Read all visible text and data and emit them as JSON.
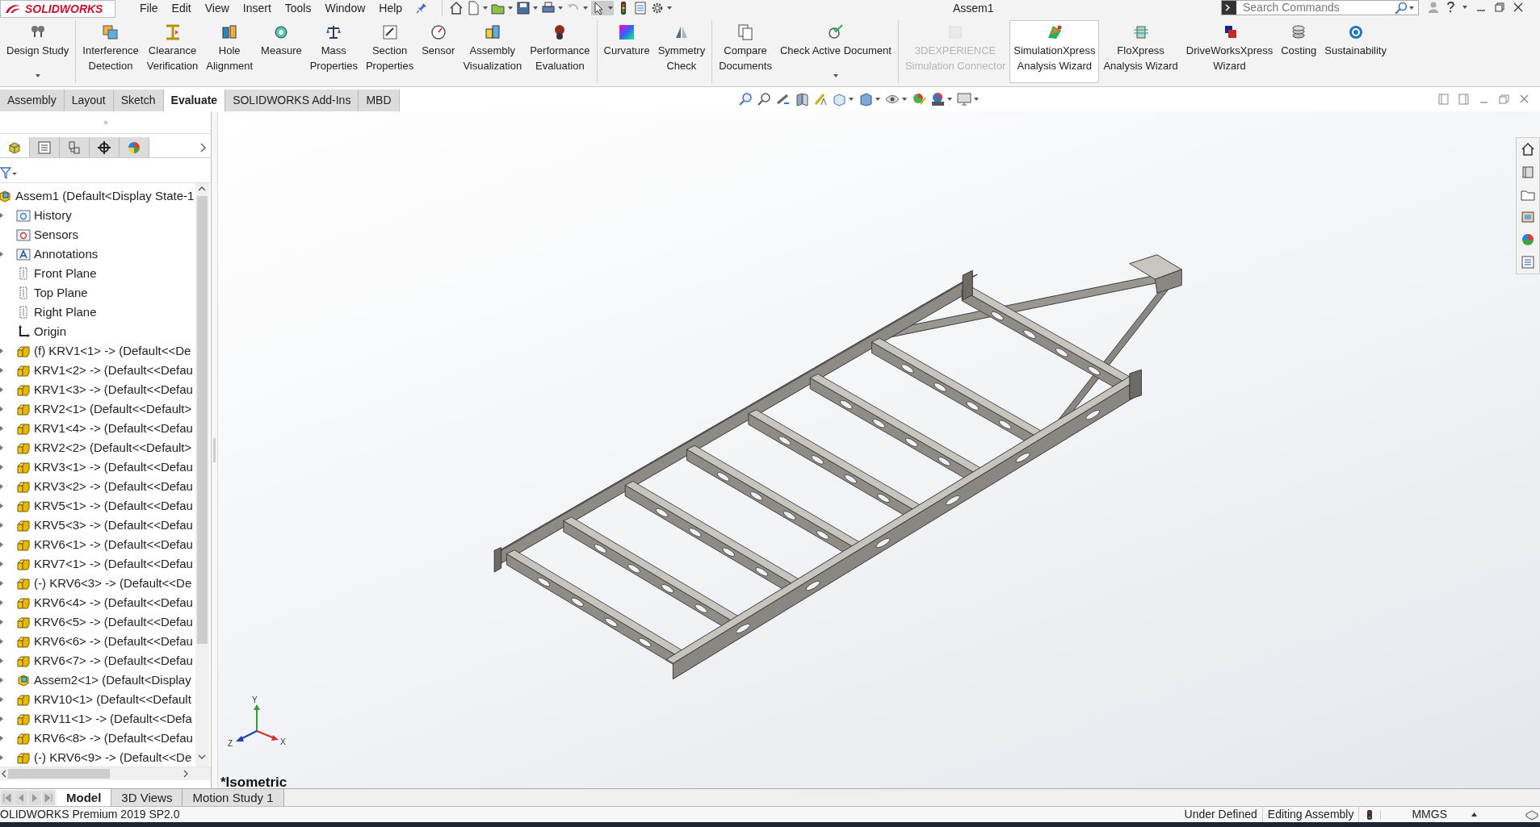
{
  "app": {
    "logo": "SOLIDWORKS",
    "menu": [
      "File",
      "Edit",
      "View",
      "Insert",
      "Tools",
      "Window",
      "Help"
    ],
    "title": "Assem1",
    "search": {
      "placeholder": "Search Commands"
    }
  },
  "ribbon": {
    "groups": [
      [
        {
          "lines": [
            "Design Study"
          ],
          "dropdown": true,
          "disabled": false,
          "hovered": false
        }
      ],
      [
        {
          "lines": [
            "Interference",
            "Detection"
          ],
          "dropdown": false,
          "disabled": false,
          "hovered": false
        },
        {
          "lines": [
            "Clearance",
            "Verification"
          ],
          "dropdown": false,
          "disabled": false,
          "hovered": false
        },
        {
          "lines": [
            "Hole",
            "Alignment"
          ],
          "dropdown": false,
          "disabled": false,
          "hovered": false
        },
        {
          "lines": [
            "Measure"
          ],
          "dropdown": false,
          "disabled": false,
          "hovered": false
        },
        {
          "lines": [
            "Mass",
            "Properties"
          ],
          "dropdown": false,
          "disabled": false,
          "hovered": false
        },
        {
          "lines": [
            "Section",
            "Properties"
          ],
          "dropdown": false,
          "disabled": false,
          "hovered": false
        },
        {
          "lines": [
            "Sensor"
          ],
          "dropdown": false,
          "disabled": false,
          "hovered": false
        },
        {
          "lines": [
            "Assembly",
            "Visualization"
          ],
          "dropdown": false,
          "disabled": false,
          "hovered": false
        },
        {
          "lines": [
            "Performance",
            "Evaluation"
          ],
          "dropdown": false,
          "disabled": false,
          "hovered": false
        }
      ],
      [
        {
          "lines": [
            "Curvature"
          ],
          "dropdown": false,
          "disabled": false,
          "hovered": false
        },
        {
          "lines": [
            "Symmetry",
            "Check"
          ],
          "dropdown": false,
          "disabled": false,
          "hovered": false
        }
      ],
      [
        {
          "lines": [
            "Compare",
            "Documents"
          ],
          "dropdown": false,
          "disabled": false,
          "hovered": false
        },
        {
          "lines": [
            "Check Active Document"
          ],
          "dropdown": true,
          "disabled": false,
          "hovered": false
        }
      ],
      [
        {
          "lines": [
            "3DEXPERIENCE",
            "Simulation Connector"
          ],
          "dropdown": false,
          "disabled": true,
          "hovered": false
        },
        {
          "lines": [
            "SimulationXpress",
            "Analysis Wizard"
          ],
          "dropdown": false,
          "disabled": false,
          "hovered": true
        },
        {
          "lines": [
            "FloXpress",
            "Analysis Wizard"
          ],
          "dropdown": false,
          "disabled": false,
          "hovered": false
        },
        {
          "lines": [
            "DriveWorksXpress",
            "Wizard"
          ],
          "dropdown": false,
          "disabled": false,
          "hovered": false
        },
        {
          "lines": [
            "Costing"
          ],
          "dropdown": false,
          "disabled": false,
          "hovered": false
        },
        {
          "lines": [
            "Sustainability"
          ],
          "dropdown": false,
          "disabled": false,
          "hovered": false
        }
      ]
    ]
  },
  "tabs": [
    {
      "label": "Assembly",
      "selected": false
    },
    {
      "label": "Layout",
      "selected": false
    },
    {
      "label": "Sketch",
      "selected": false
    },
    {
      "label": "Evaluate",
      "selected": true
    },
    {
      "label": "SOLIDWORKS Add-Ins",
      "selected": false
    },
    {
      "label": "MBD",
      "selected": false
    }
  ],
  "panel_tabs": [
    {
      "selected": true
    },
    {
      "selected": false
    },
    {
      "selected": false
    },
    {
      "selected": false
    },
    {
      "selected": false
    }
  ],
  "feature_tree": {
    "root": {
      "label": "Assem1  (Default<Display State-1",
      "kind": "assembly",
      "expanded": true,
      "children": [
        {
          "label": "History",
          "kind": "history",
          "expanded": false
        },
        {
          "label": "Sensors",
          "kind": "sensors"
        },
        {
          "label": "Annotations",
          "kind": "annotations",
          "expanded": false
        },
        {
          "label": "Front Plane",
          "kind": "plane"
        },
        {
          "label": "Top Plane",
          "kind": "plane"
        },
        {
          "label": "Right Plane",
          "kind": "plane"
        },
        {
          "label": "Origin",
          "kind": "origin"
        },
        {
          "label": "(f) KRV1<1> -> (Default<<De",
          "kind": "part",
          "expanded": false
        },
        {
          "label": "KRV1<2> -> (Default<<Defau",
          "kind": "part",
          "expanded": false
        },
        {
          "label": "KRV1<3> -> (Default<<Defau",
          "kind": "part",
          "expanded": false
        },
        {
          "label": "KRV2<1> (Default<<Default>",
          "kind": "part",
          "expanded": false
        },
        {
          "label": "KRV1<4> -> (Default<<Defau",
          "kind": "part",
          "expanded": false
        },
        {
          "label": "KRV2<2> (Default<<Default>",
          "kind": "part",
          "expanded": false
        },
        {
          "label": "KRV3<1> -> (Default<<Defau",
          "kind": "part",
          "expanded": false
        },
        {
          "label": "KRV3<2> -> (Default<<Defau",
          "kind": "part",
          "expanded": false
        },
        {
          "label": "KRV5<1> -> (Default<<Defau",
          "kind": "part",
          "expanded": false
        },
        {
          "label": "KRV5<3> -> (Default<<Defau",
          "kind": "part",
          "expanded": false
        },
        {
          "label": "KRV6<1> -> (Default<<Defau",
          "kind": "part",
          "expanded": false
        },
        {
          "label": "KRV7<1> -> (Default<<Defau",
          "kind": "part",
          "expanded": false
        },
        {
          "label": "(-) KRV6<3> -> (Default<<De",
          "kind": "part",
          "expanded": false
        },
        {
          "label": "KRV6<4> -> (Default<<Defau",
          "kind": "part",
          "expanded": false
        },
        {
          "label": "KRV6<5> -> (Default<<Defau",
          "kind": "part",
          "expanded": false
        },
        {
          "label": "KRV6<6> -> (Default<<Defau",
          "kind": "part",
          "expanded": false
        },
        {
          "label": "KRV6<7> -> (Default<<Defau",
          "kind": "part",
          "expanded": false
        },
        {
          "label": "Assem2<1> (Default<Display",
          "kind": "subassembly",
          "expanded": false
        },
        {
          "label": "KRV10<1> (Default<<Default",
          "kind": "part",
          "expanded": false
        },
        {
          "label": "KRV11<1> -> (Default<<Defa",
          "kind": "part",
          "expanded": false
        },
        {
          "label": "KRV6<8> -> (Default<<Defau",
          "kind": "part",
          "expanded": false
        },
        {
          "label": "(-) KRV6<9> -> (Default<<De",
          "kind": "part",
          "expanded": false
        }
      ]
    }
  },
  "viewport": {
    "triad": {
      "y": "Y",
      "x": "X",
      "z": "Z"
    },
    "view_label": "*Isometric"
  },
  "bottom_tabs": [
    {
      "label": "Model",
      "selected": true
    },
    {
      "label": "3D Views",
      "selected": false
    },
    {
      "label": "Motion Study 1",
      "selected": false
    }
  ],
  "status_bar": {
    "product": "OLIDWORKS Premium 2019 SP2.0",
    "state": "Under Defined",
    "mode": "Editing Assembly",
    "units": "MMGS"
  }
}
